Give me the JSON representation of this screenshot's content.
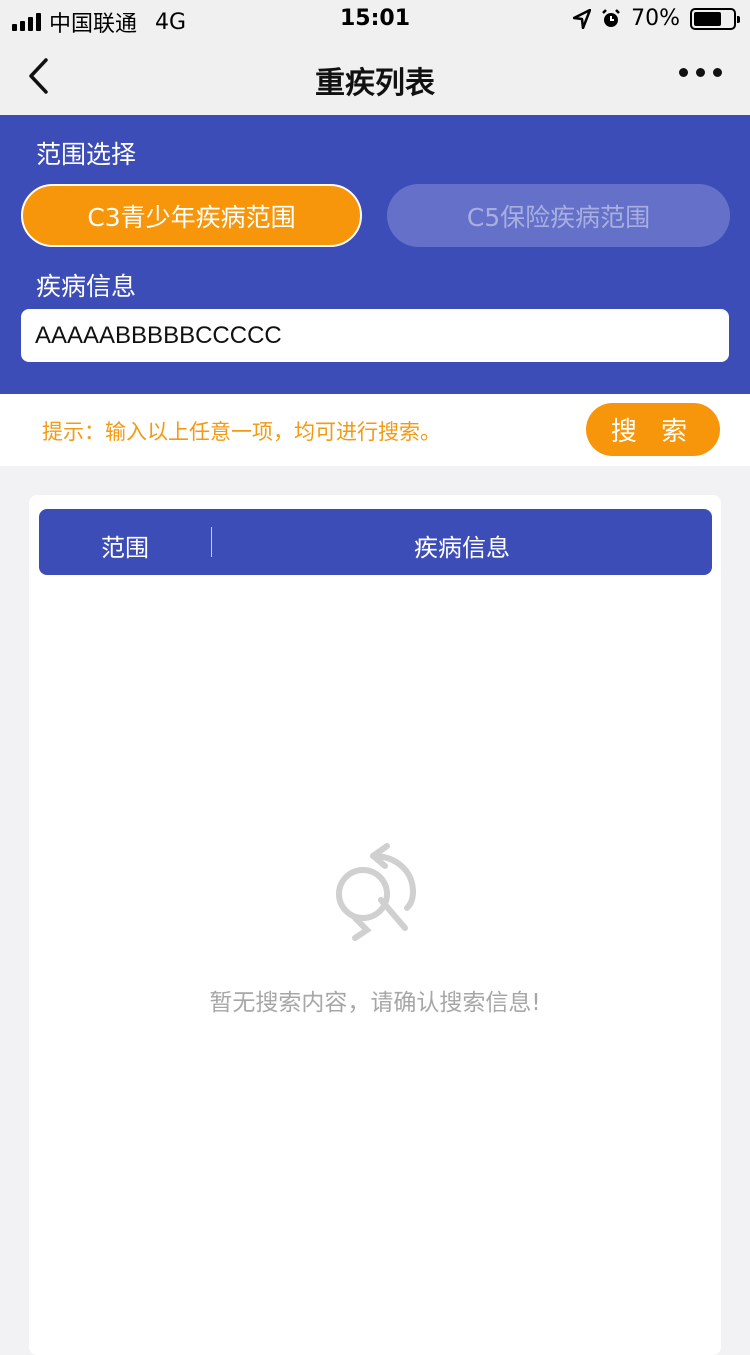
{
  "status_bar": {
    "carrier": "中国联通",
    "network": "4G",
    "time": "15:01",
    "battery": "70%",
    "battery_level": 0.7
  },
  "nav": {
    "title": "重疾列表",
    "back_icon": "chevron-left-icon",
    "more_icon": "more-dots-icon"
  },
  "filter": {
    "scope_label": "范围选择",
    "scope_options": [
      "C3青少年疾病范围",
      "C5保险疾病范围"
    ],
    "selected_scope": "C3青少年疾病范围",
    "disease_label": "疾病信息",
    "disease_value": "AAAAABBBBBCCCCC",
    "disease_placeholder": ""
  },
  "hint": {
    "text": "提示：输入以上任意一项，均可进行搜索。",
    "search_label": "搜 索"
  },
  "results": {
    "columns": [
      "范围",
      "疾病信息"
    ],
    "empty_icon": "no-results-icon",
    "empty_text": "暂无搜索内容，请确认搜索信息!"
  },
  "colors": {
    "primary": "#3d4db7",
    "accent": "#f7960b",
    "hint": "#f39a12"
  }
}
